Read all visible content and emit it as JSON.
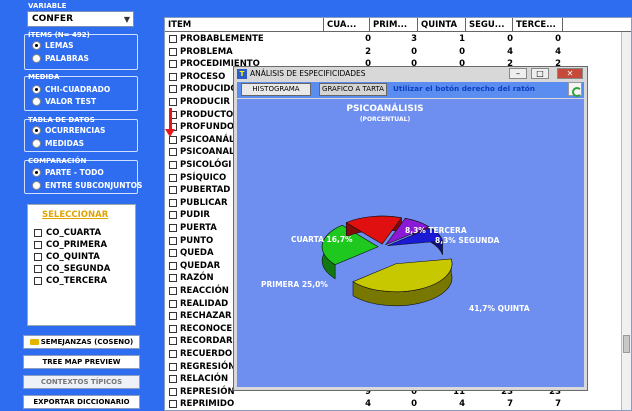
{
  "sidebar": {
    "variable_label": "VARIABLE",
    "variable_value": "CONFER",
    "items_label": "ÍTEMS (N= 492)",
    "items_options": [
      "LEMAS",
      "PALABRAS"
    ],
    "medida_label": "MEDIDA",
    "medida_options": [
      "CHI-CUADRADO",
      "VALOR TEST"
    ],
    "tabla_label": "TABLA DE DATOS",
    "tabla_options": [
      "OCURRENCIAS",
      "MEDIDAS"
    ],
    "comparacion_label": "COMPARACIÓN",
    "comparacion_options": [
      "PARTE - TODO",
      "ENTRE SUBCONJUNTOS"
    ],
    "seleccionar_title": "SELECCIONAR",
    "seleccionar_items": [
      "CO_CUARTA",
      "CO_PRIMERA",
      "CO_QUINTA",
      "CO_SEGUNDA",
      "CO_TERCERA"
    ],
    "buttons": {
      "semejanzas": "SEMEJANZAS (COSENO)",
      "treemap": "TREE MAP PREVIEW",
      "contextos": "CONTEXTOS TÍPICOS",
      "exportar": "EXPORTAR DICCIONARIO"
    }
  },
  "table": {
    "headers": [
      "ITEM",
      "CUA...",
      "PRIM...",
      "QUINTA",
      "SEGU...",
      "TERCE..."
    ],
    "rows": [
      {
        "item": "PROBABLEMENTE",
        "vals": [
          "0",
          "3",
          "1",
          "0",
          "0"
        ]
      },
      {
        "item": "PROBLEMA",
        "vals": [
          "2",
          "0",
          "0",
          "4",
          "4"
        ]
      },
      {
        "item": "PROCEDIMIENTO",
        "vals": [
          "0",
          "0",
          "0",
          "2",
          "2"
        ]
      },
      {
        "item": "PROCESO",
        "vals": [
          "",
          "",
          "",
          "",
          ""
        ]
      },
      {
        "item": "PRODUCIDO",
        "vals": [
          "",
          "",
          "",
          "",
          ""
        ]
      },
      {
        "item": "PRODUCIR",
        "vals": [
          "",
          "",
          "",
          "",
          ""
        ]
      },
      {
        "item": "PRODUCTO",
        "vals": [
          "",
          "",
          "",
          "",
          ""
        ]
      },
      {
        "item": "PROFUNDO",
        "vals": [
          "",
          "",
          "",
          "",
          ""
        ]
      },
      {
        "item": "PSICOANÁL",
        "vals": [
          "",
          "",
          "",
          "",
          ""
        ]
      },
      {
        "item": "PSICOANAL",
        "vals": [
          "",
          "",
          "",
          "",
          ""
        ]
      },
      {
        "item": "PSICOLÓGI",
        "vals": [
          "",
          "",
          "",
          "",
          ""
        ]
      },
      {
        "item": "PSÍQUICO",
        "vals": [
          "",
          "",
          "",
          "",
          ""
        ]
      },
      {
        "item": "PUBERTAD",
        "vals": [
          "",
          "",
          "",
          "",
          ""
        ]
      },
      {
        "item": "PUBLICAR",
        "vals": [
          "",
          "",
          "",
          "",
          ""
        ]
      },
      {
        "item": "PUDIR",
        "vals": [
          "",
          "",
          "",
          "",
          ""
        ]
      },
      {
        "item": "PUERTA",
        "vals": [
          "",
          "",
          "",
          "",
          ""
        ]
      },
      {
        "item": "PUNTO",
        "vals": [
          "",
          "",
          "",
          "",
          ""
        ]
      },
      {
        "item": "QUEDA",
        "vals": [
          "",
          "",
          "",
          "",
          ""
        ]
      },
      {
        "item": "QUEDAR",
        "vals": [
          "",
          "",
          "",
          "",
          ""
        ]
      },
      {
        "item": "RAZÓN",
        "vals": [
          "",
          "",
          "",
          "",
          ""
        ]
      },
      {
        "item": "REACCIÓN",
        "vals": [
          "",
          "",
          "",
          "",
          ""
        ]
      },
      {
        "item": "REALIDAD",
        "vals": [
          "",
          "",
          "",
          "",
          ""
        ]
      },
      {
        "item": "RECHAZAR",
        "vals": [
          "",
          "",
          "",
          "",
          ""
        ]
      },
      {
        "item": "RECONOCE",
        "vals": [
          "",
          "",
          "",
          "",
          ""
        ]
      },
      {
        "item": "RECORDAR",
        "vals": [
          "",
          "",
          "",
          "",
          ""
        ]
      },
      {
        "item": "RECUERDO",
        "vals": [
          "",
          "",
          "",
          "",
          ""
        ]
      },
      {
        "item": "REGRESIÓN",
        "vals": [
          "",
          "",
          "",
          "",
          ""
        ]
      },
      {
        "item": "RELACIÓN",
        "vals": [
          "",
          "",
          "",
          "",
          ""
        ]
      },
      {
        "item": "REPRESIÓN",
        "vals": [
          "9",
          "0",
          "11",
          "23",
          "23"
        ]
      },
      {
        "item": "REPRIMIDO",
        "vals": [
          "4",
          "0",
          "4",
          "7",
          "7"
        ]
      }
    ]
  },
  "window": {
    "title": "ANÁLISIS DE ESPECIFICIDADES",
    "btn_histograma": "HISTOGRAMA",
    "btn_tarta": "GRAFICO A TARTA",
    "hint": "Utilizar el botón derecho del ratón"
  },
  "chart_data": {
    "type": "pie",
    "title": "PSICOANÁLISIS",
    "subtitle": "(PORCENTUAL)",
    "slices": [
      {
        "label": "QUINTA",
        "value": 41.7,
        "text": "41,7%  QUINTA",
        "color": "#c8c800"
      },
      {
        "label": "PRIMERA",
        "value": 25.0,
        "text": "PRIMERA  25,0%",
        "color": "#1ec81e"
      },
      {
        "label": "CUARTA",
        "value": 16.7,
        "text": "CUARTA  16,7%",
        "color": "#e01010"
      },
      {
        "label": "TERCERA",
        "value": 8.3,
        "text": "8,3%  TERCERA",
        "color": "#8a1ad6"
      },
      {
        "label": "SEGUNDA",
        "value": 8.3,
        "text": "8,3%  SEGUNDA",
        "color": "#1a1ad6"
      }
    ]
  },
  "colors": {
    "background": "#2f6df0",
    "chart_bg": "#6e8ff0",
    "arrow": "#e21818"
  }
}
